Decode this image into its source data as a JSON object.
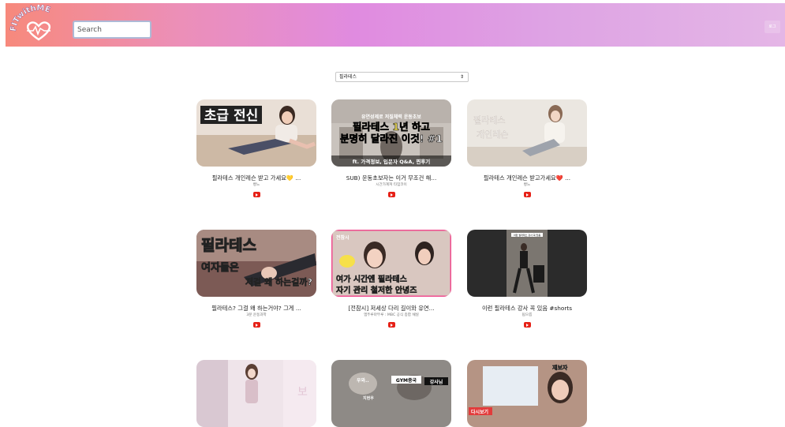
{
  "header": {
    "logo_text": "FITwithME",
    "search_placeholder": "Search",
    "right_button_label": "로그"
  },
  "filter": {
    "selected": "필라테스"
  },
  "colors": {
    "header_gradient": [
      "#f7897c",
      "#e08be0",
      "#e4b6e6"
    ],
    "play_red": "#e62117"
  },
  "videos": [
    {
      "title": "필라테스 개인레슨 받고 가세요💛 ...",
      "channel": "빵느",
      "thumb_text": [
        "초급 전신"
      ]
    },
    {
      "title": "SUB) 운동초보자는 이거 무조건 해...",
      "channel": "시간가계져 타임코이",
      "thumb_text": [
        "유연성제로 저질체력 운동초보",
        "필라테스 1년 하고",
        "분명히 달라진 이것! #1",
        "ft. 가격정보, 입문자 Q&A, 찐후기"
      ]
    },
    {
      "title": "필라테스 개인레슨 받고가세요❤️ ...",
      "channel": "빵느",
      "thumb_text": [
        "필라테스",
        "개인레슨"
      ]
    },
    {
      "title": "필라테스? 그걸 왜 하는거야? 그게 ...",
      "channel": "3분 운동과학",
      "thumb_text": [
        "필라테스",
        "여자들은",
        "저걸 왜 하는걸까?"
      ]
    },
    {
      "title": "[전참시] 저세상 다리 길이와 유연...",
      "channel": "엠뚜루마뚜루 : MBC 공식 종합 채널",
      "thumb_text": [
        "전참시",
        "여가 시간엔 필라테스",
        "자기 관리 철저한 안녕즈"
      ]
    },
    {
      "title": "이런 필라테스 강사 꼭 있음 #shorts",
      "channel": "됩으릅",
      "thumb_text": [
        "이런 필라테스 강사 꼭 있음"
      ]
    },
    {
      "title": "",
      "channel": "",
      "thumb_text": [
        "보"
      ]
    },
    {
      "title": "",
      "channel": "",
      "thumb_text": [
        "우와..",
        "GYM종국",
        "강사님",
        "지현우"
      ]
    },
    {
      "title": "",
      "channel": "",
      "thumb_text": [
        "재보자",
        "다시보기"
      ]
    }
  ]
}
